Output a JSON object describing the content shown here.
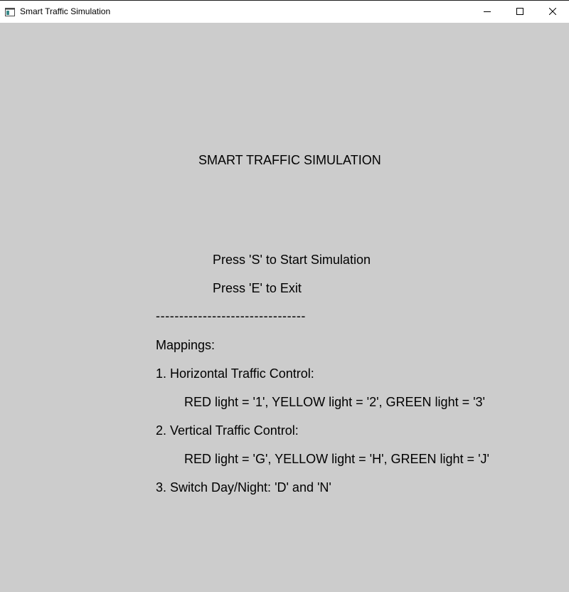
{
  "window": {
    "title": "Smart Traffic Simulation",
    "icon": "app-window-icon"
  },
  "controls": {
    "minimize_icon": "minimize-icon",
    "maximize_icon": "maximize-icon",
    "close_icon": "close-icon"
  },
  "screen": {
    "heading": "SMART TRAFFIC SIMULATION",
    "start_hint": "Press 'S' to Start Simulation",
    "exit_hint": "Press 'E' to Exit",
    "divider": "--------------------------------",
    "mappings_title": "Mappings:",
    "mappings": [
      {
        "title": "1. Horizontal Traffic Control:",
        "detail": "RED light = '1', YELLOW light = '2', GREEN light = '3'"
      },
      {
        "title": "2. Vertical Traffic Control:",
        "detail": "RED light = 'G', YELLOW light = 'H', GREEN light = 'J'"
      },
      {
        "title": "3. Switch Day/Night: 'D' and 'N'"
      }
    ]
  },
  "colors": {
    "background": "#cccccc",
    "titlebar": "#ffffff",
    "text": "#000000"
  }
}
